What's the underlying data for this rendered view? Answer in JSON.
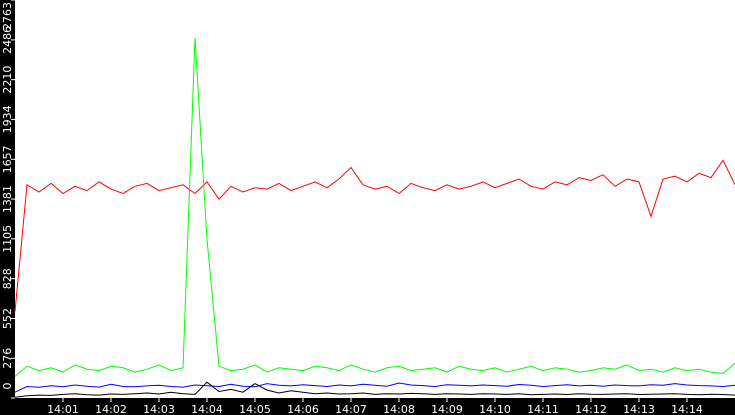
{
  "chart_data": {
    "type": "line",
    "title": "",
    "xlabel": "",
    "ylabel": "",
    "x_start_seconds": 0,
    "x_step_seconds": 15,
    "xlim_seconds": [
      0,
      900
    ],
    "ylim": [
      0,
      2763
    ],
    "y_ticks": [
      "0",
      "276",
      "552",
      "828",
      "1105",
      "1381",
      "1657",
      "1934",
      "2210",
      "2486",
      "2763"
    ],
    "x_ticks": [
      "14:01",
      "14:02",
      "14:03",
      "14:04",
      "14:05",
      "14:06",
      "14:07",
      "14:08",
      "14:09",
      "14:10",
      "14:11",
      "14:12",
      "14:13",
      "14:14"
    ],
    "grid": false,
    "legend": "none",
    "series": [
      {
        "name": "red",
        "color": "#ff0000",
        "values": [
          600,
          1480,
          1430,
          1490,
          1420,
          1470,
          1440,
          1500,
          1450,
          1420,
          1470,
          1490,
          1440,
          1460,
          1480,
          1420,
          1500,
          1380,
          1470,
          1430,
          1460,
          1450,
          1490,
          1440,
          1470,
          1500,
          1460,
          1520,
          1600,
          1480,
          1450,
          1470,
          1420,
          1490,
          1460,
          1440,
          1480,
          1450,
          1470,
          1500,
          1460,
          1490,
          1520,
          1470,
          1450,
          1500,
          1480,
          1530,
          1510,
          1550,
          1470,
          1520,
          1500,
          1260,
          1520,
          1540,
          1500,
          1560,
          1530,
          1650,
          1480
        ]
      },
      {
        "name": "green",
        "color": "#00ff00",
        "values": [
          150,
          220,
          190,
          210,
          180,
          230,
          200,
          190,
          220,
          210,
          180,
          200,
          230,
          190,
          210,
          2500,
          1100,
          220,
          190,
          200,
          230,
          180,
          210,
          200,
          190,
          220,
          210,
          190,
          230,
          200,
          180,
          210,
          220,
          190,
          200,
          210,
          180,
          220,
          200,
          190,
          210,
          180,
          200,
          220,
          190,
          210,
          200,
          180,
          190,
          210,
          200,
          230,
          190,
          200,
          180,
          210,
          190,
          200,
          180,
          170,
          240
        ]
      },
      {
        "name": "blue",
        "color": "#0000ff",
        "values": [
          40,
          80,
          75,
          85,
          78,
          90,
          82,
          76,
          95,
          80,
          78,
          84,
          88,
          80,
          76,
          90,
          85,
          80,
          95,
          82,
          78,
          100,
          88,
          84,
          92,
          86,
          80,
          90,
          84,
          96,
          88,
          82,
          104,
          90,
          86,
          80,
          92,
          88,
          84,
          90,
          86,
          82,
          94,
          88,
          80,
          86,
          92,
          84,
          88,
          82,
          90,
          86,
          84,
          92,
          88,
          100,
          90,
          86,
          84,
          80,
          88
        ]
      },
      {
        "name": "black",
        "color": "#000000",
        "values": [
          5,
          15,
          20,
          18,
          25,
          30,
          22,
          20,
          28,
          25,
          30,
          35,
          28,
          40,
          30,
          25,
          110,
          45,
          60,
          40,
          100,
          55,
          35,
          50,
          40,
          30,
          35,
          28,
          30,
          35,
          25,
          30,
          28,
          32,
          30,
          25,
          30,
          28,
          25,
          30,
          28,
          25,
          30,
          22,
          25,
          28,
          24,
          30,
          26,
          25,
          28,
          30,
          24,
          26,
          28,
          30,
          25,
          22,
          26,
          24,
          20
        ]
      }
    ]
  }
}
